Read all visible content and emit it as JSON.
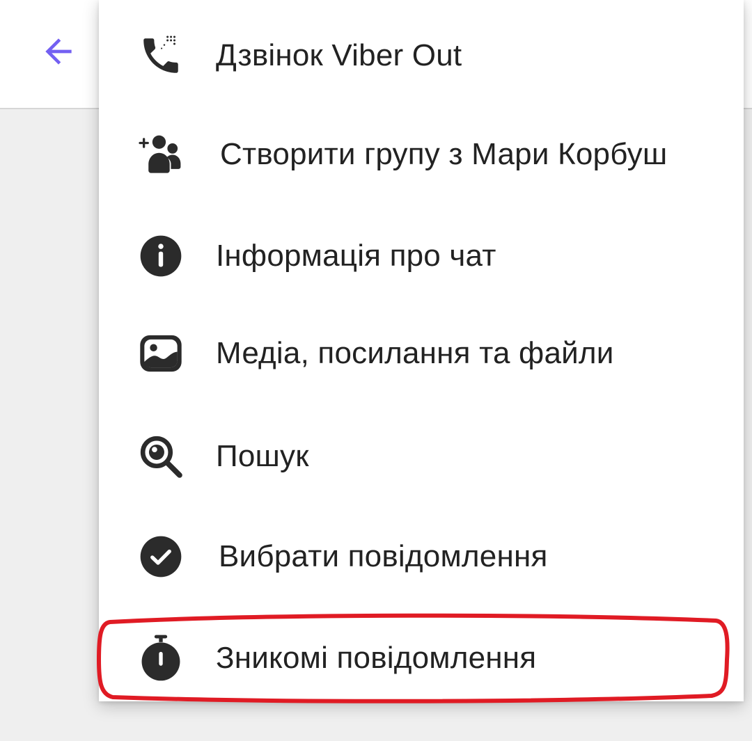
{
  "header": {
    "back_icon": "arrow-left-icon",
    "accent_color": "#7360f2"
  },
  "menu": {
    "items": [
      {
        "label": "Дзвінок Viber Out",
        "icon": "phone-viber-out-icon"
      },
      {
        "label": "Створити групу з Мари Корбуш",
        "icon": "add-group-icon"
      },
      {
        "label": "Інформація про чат",
        "icon": "info-icon"
      },
      {
        "label": "Медіа, посилання та файли",
        "icon": "image-icon"
      },
      {
        "label": "Пошук",
        "icon": "search-icon"
      },
      {
        "label": "Вибрати повідомлення",
        "icon": "check-circle-icon"
      },
      {
        "label": "Зникомі повідомлення",
        "icon": "timer-icon"
      }
    ]
  },
  "annotation": {
    "highlight_color": "#e01b24"
  },
  "colors": {
    "icon": "#2b2b2b",
    "text": "#222222"
  }
}
